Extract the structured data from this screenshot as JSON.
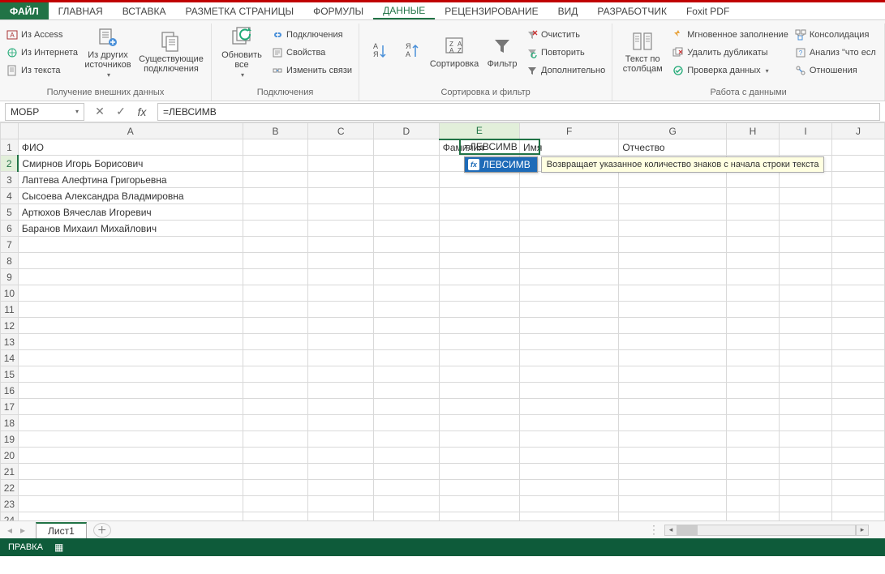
{
  "tabs": {
    "file": "ФАЙЛ",
    "items": [
      "ГЛАВНАЯ",
      "ВСТАВКА",
      "РАЗМЕТКА СТРАНИЦЫ",
      "ФОРМУЛЫ",
      "ДАННЫЕ",
      "РЕЦЕНЗИРОВАНИЕ",
      "ВИД",
      "РАЗРАБОТЧИК",
      "Foxit PDF"
    ],
    "active_index": 4
  },
  "ribbon": {
    "group_ext": {
      "from_access": "Из Access",
      "from_web": "Из Интернета",
      "from_text": "Из текста",
      "other_sources": "Из других источников",
      "existing_conn": "Существующие подключения",
      "label": "Получение внешних данных"
    },
    "group_conn": {
      "refresh_all": "Обновить все",
      "connections": "Подключения",
      "properties": "Свойства",
      "edit_links": "Изменить связи",
      "label": "Подключения"
    },
    "group_sort": {
      "sort": "Сортировка",
      "filter": "Фильтр",
      "clear": "Очистить",
      "reapply": "Повторить",
      "advanced": "Дополнительно",
      "label": "Сортировка и фильтр"
    },
    "group_data": {
      "text_to_cols": "Текст по столбцам",
      "flash_fill": "Мгновенное заполнение",
      "remove_dup": "Удалить дубликаты",
      "data_val": "Проверка данных",
      "consolidate": "Консолидация",
      "what_if": "Анализ \"что есл",
      "relationships": "Отношения",
      "label": "Работа с данными"
    }
  },
  "namebox": "МОБР",
  "formula": "=ЛЕВСИМВ",
  "columns": [
    "A",
    "B",
    "C",
    "D",
    "E",
    "F",
    "G",
    "H",
    "I",
    "J"
  ],
  "row_count": 24,
  "cell_data": {
    "A1": "ФИО",
    "E1": "Фамилия",
    "F1": "Имя",
    "G1": "Отчество",
    "A2": "Смирнов Игорь Борисович",
    "A3": "Лаптева Алефтина Григорьевна",
    "A4": "Сысоева Александра Владмировна",
    "A5": "Артюхов Вячеслав Игоревич",
    "A6": "Баранов Михаил Михайлович"
  },
  "active_cell": {
    "ref": "E2",
    "display": "=ЛЕВСИМВ"
  },
  "autocomplete": {
    "item": "ЛЕВСИМВ",
    "desc": "Возвращает указанное количество знаков с начала строки текста"
  },
  "sheet": {
    "name": "Лист1"
  },
  "status": {
    "mode": "ПРАВКА"
  }
}
